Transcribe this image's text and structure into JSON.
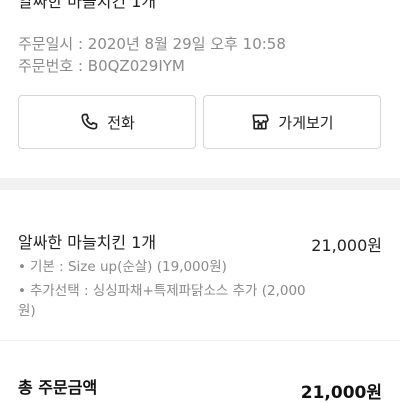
{
  "order": {
    "title_cut": "알싸한 마늘치킨 1개",
    "date_text": "주문일시 : 2020년 8월 29일 오후 10:58",
    "number_text": "주문번호 : B0QZ029IYM"
  },
  "actions": {
    "call_label": "전화",
    "store_label": "가게보기",
    "call_icon": "phone-icon",
    "store_icon": "store-icon"
  },
  "item": {
    "name": "알싸한 마늘치킨 1개",
    "price": "21,000원",
    "options": [
      "기본 : Size up(순살) (19,000원)",
      "추가선택 : 싱싱파채+특제파닭소스 추가 (2,000원)"
    ]
  },
  "total": {
    "label": "총 주문금액",
    "value": "21,000원"
  }
}
